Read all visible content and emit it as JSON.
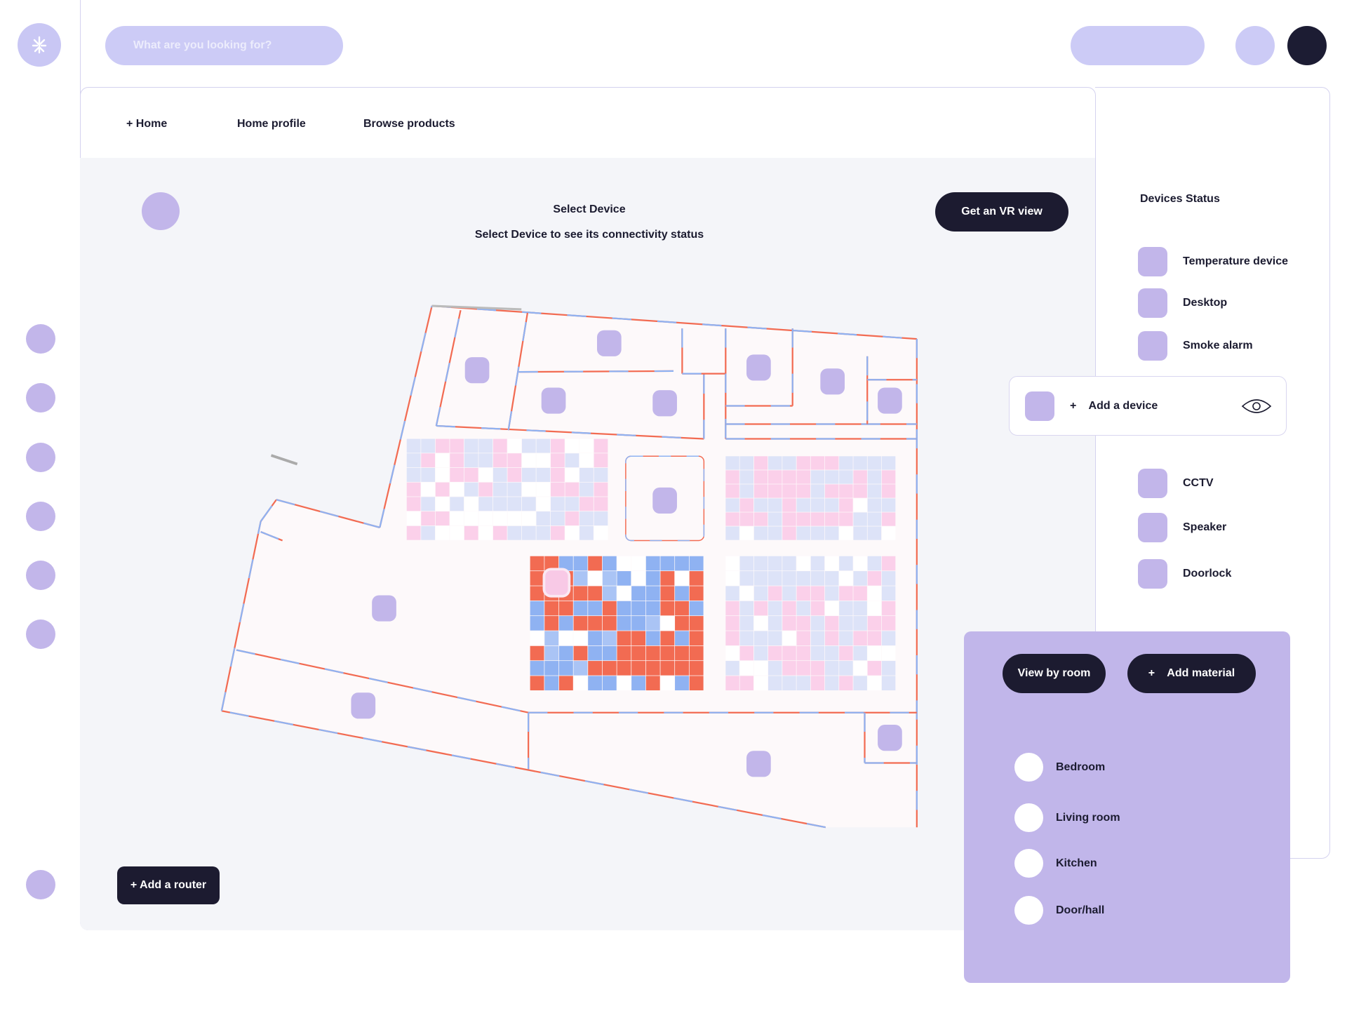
{
  "header": {
    "search_placeholder": "What are you looking for?"
  },
  "nav": {
    "items": [
      "+  Home",
      "Home profile",
      "Browse products"
    ]
  },
  "main": {
    "select_title": "Select Device",
    "select_subtitle": "Select Device to see its connectivity status",
    "vr_button": "Get an VR view",
    "add_router": "+ Add a router"
  },
  "devices": {
    "title": "Devices Status",
    "items": [
      "Temperature device",
      "Desktop",
      "Smoke alarm",
      "CCTV",
      "Speaker",
      "Doorlock"
    ],
    "add_device": "+    Add a device"
  },
  "panel": {
    "view_by_room": "View by room",
    "add_material": "+    Add material",
    "rooms": [
      "Bedroom",
      "Living room",
      "Kitchen",
      "Door/hall"
    ]
  },
  "colors": {
    "accent": "#c1b6ea",
    "dark": "#1c1b30",
    "strong_signal": "#f26b52",
    "weak_signal": "#8fb2f2"
  }
}
